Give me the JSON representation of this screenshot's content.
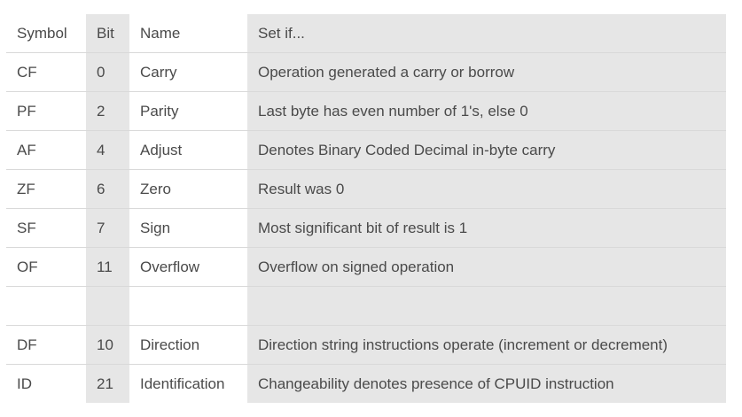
{
  "table": {
    "headers": {
      "symbol": "Symbol",
      "bit": "Bit",
      "name": "Name",
      "description": "Set if..."
    },
    "rows": [
      {
        "symbol": "CF",
        "bit": "0",
        "name": "Carry",
        "description": "Operation generated a carry or borrow"
      },
      {
        "symbol": "PF",
        "bit": "2",
        "name": "Parity",
        "description": "Last byte has even number of 1's, else 0"
      },
      {
        "symbol": "AF",
        "bit": "4",
        "name": "Adjust",
        "description": "Denotes Binary Coded Decimal in-byte carry"
      },
      {
        "symbol": "ZF",
        "bit": "6",
        "name": "Zero",
        "description": "Result was 0"
      },
      {
        "symbol": "SF",
        "bit": "7",
        "name": "Sign",
        "description": "Most significant bit of result is 1"
      },
      {
        "symbol": "OF",
        "bit": "11",
        "name": "Overflow",
        "description": "Overflow on signed operation"
      },
      {
        "symbol": "",
        "bit": "",
        "name": "",
        "description": ""
      },
      {
        "symbol": "DF",
        "bit": "10",
        "name": "Direction",
        "description": "Direction string instructions operate (increment or decrement)"
      },
      {
        "symbol": "ID",
        "bit": "21",
        "name": "Identification",
        "description": "Changeability denotes presence of CPUID instruction"
      }
    ]
  },
  "colors": {
    "shaded_column": "#e6e6e6",
    "text": "#4a4a4a",
    "row_divider": "#d9d9d9"
  }
}
